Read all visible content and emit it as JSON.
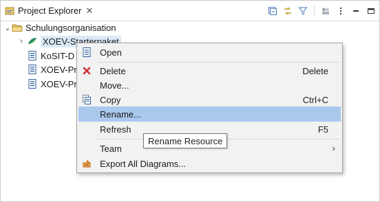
{
  "view": {
    "title": "Project Explorer",
    "close_glyph": "✕",
    "icon": "project-explorer-icon"
  },
  "toolbar": [
    {
      "name": "collapse-all-icon"
    },
    {
      "name": "link-with-editor-icon"
    },
    {
      "name": "filter-icon"
    },
    {
      "name": "working-sets-icon"
    },
    {
      "name": "view-menu-icon"
    },
    {
      "name": "minimize-icon"
    },
    {
      "name": "maximize-icon"
    }
  ],
  "tree": {
    "root": {
      "twisty": "⌄",
      "label": "Schulungsorganisation"
    },
    "items": [
      {
        "twisty": "›",
        "label": "XOEV-Starterpaket",
        "selected": true
      },
      {
        "twisty": "",
        "label": "KoSIT-D"
      },
      {
        "twisty": "",
        "label": "XOEV-Pr"
      },
      {
        "twisty": "",
        "label": "XOEV-Pr"
      }
    ]
  },
  "menu": {
    "items": [
      {
        "label": "Open",
        "key": "",
        "icon": "open-icon"
      },
      {
        "label": "Delete",
        "key": "Delete",
        "icon": "delete-icon"
      },
      {
        "label": "Move...",
        "key": "",
        "icon": ""
      },
      {
        "label": "Copy",
        "key": "Ctrl+C",
        "icon": "copy-icon"
      },
      {
        "label": "Rename...",
        "key": "",
        "icon": "",
        "highlighted": true
      },
      {
        "label": "Refresh",
        "key": "F5",
        "icon": ""
      },
      {
        "label": "Team",
        "key": "",
        "icon": "",
        "submenu": "›"
      },
      {
        "label": "Export All Diagrams...",
        "key": "",
        "icon": "export-diagrams-icon"
      }
    ]
  },
  "tooltip": {
    "text": "Rename Resource"
  },
  "colors": {
    "menu_bg": "#f2f2f2",
    "highlight": "#a9c8ec",
    "selection": "#dbe9f7",
    "delete_red": "#d13438"
  }
}
